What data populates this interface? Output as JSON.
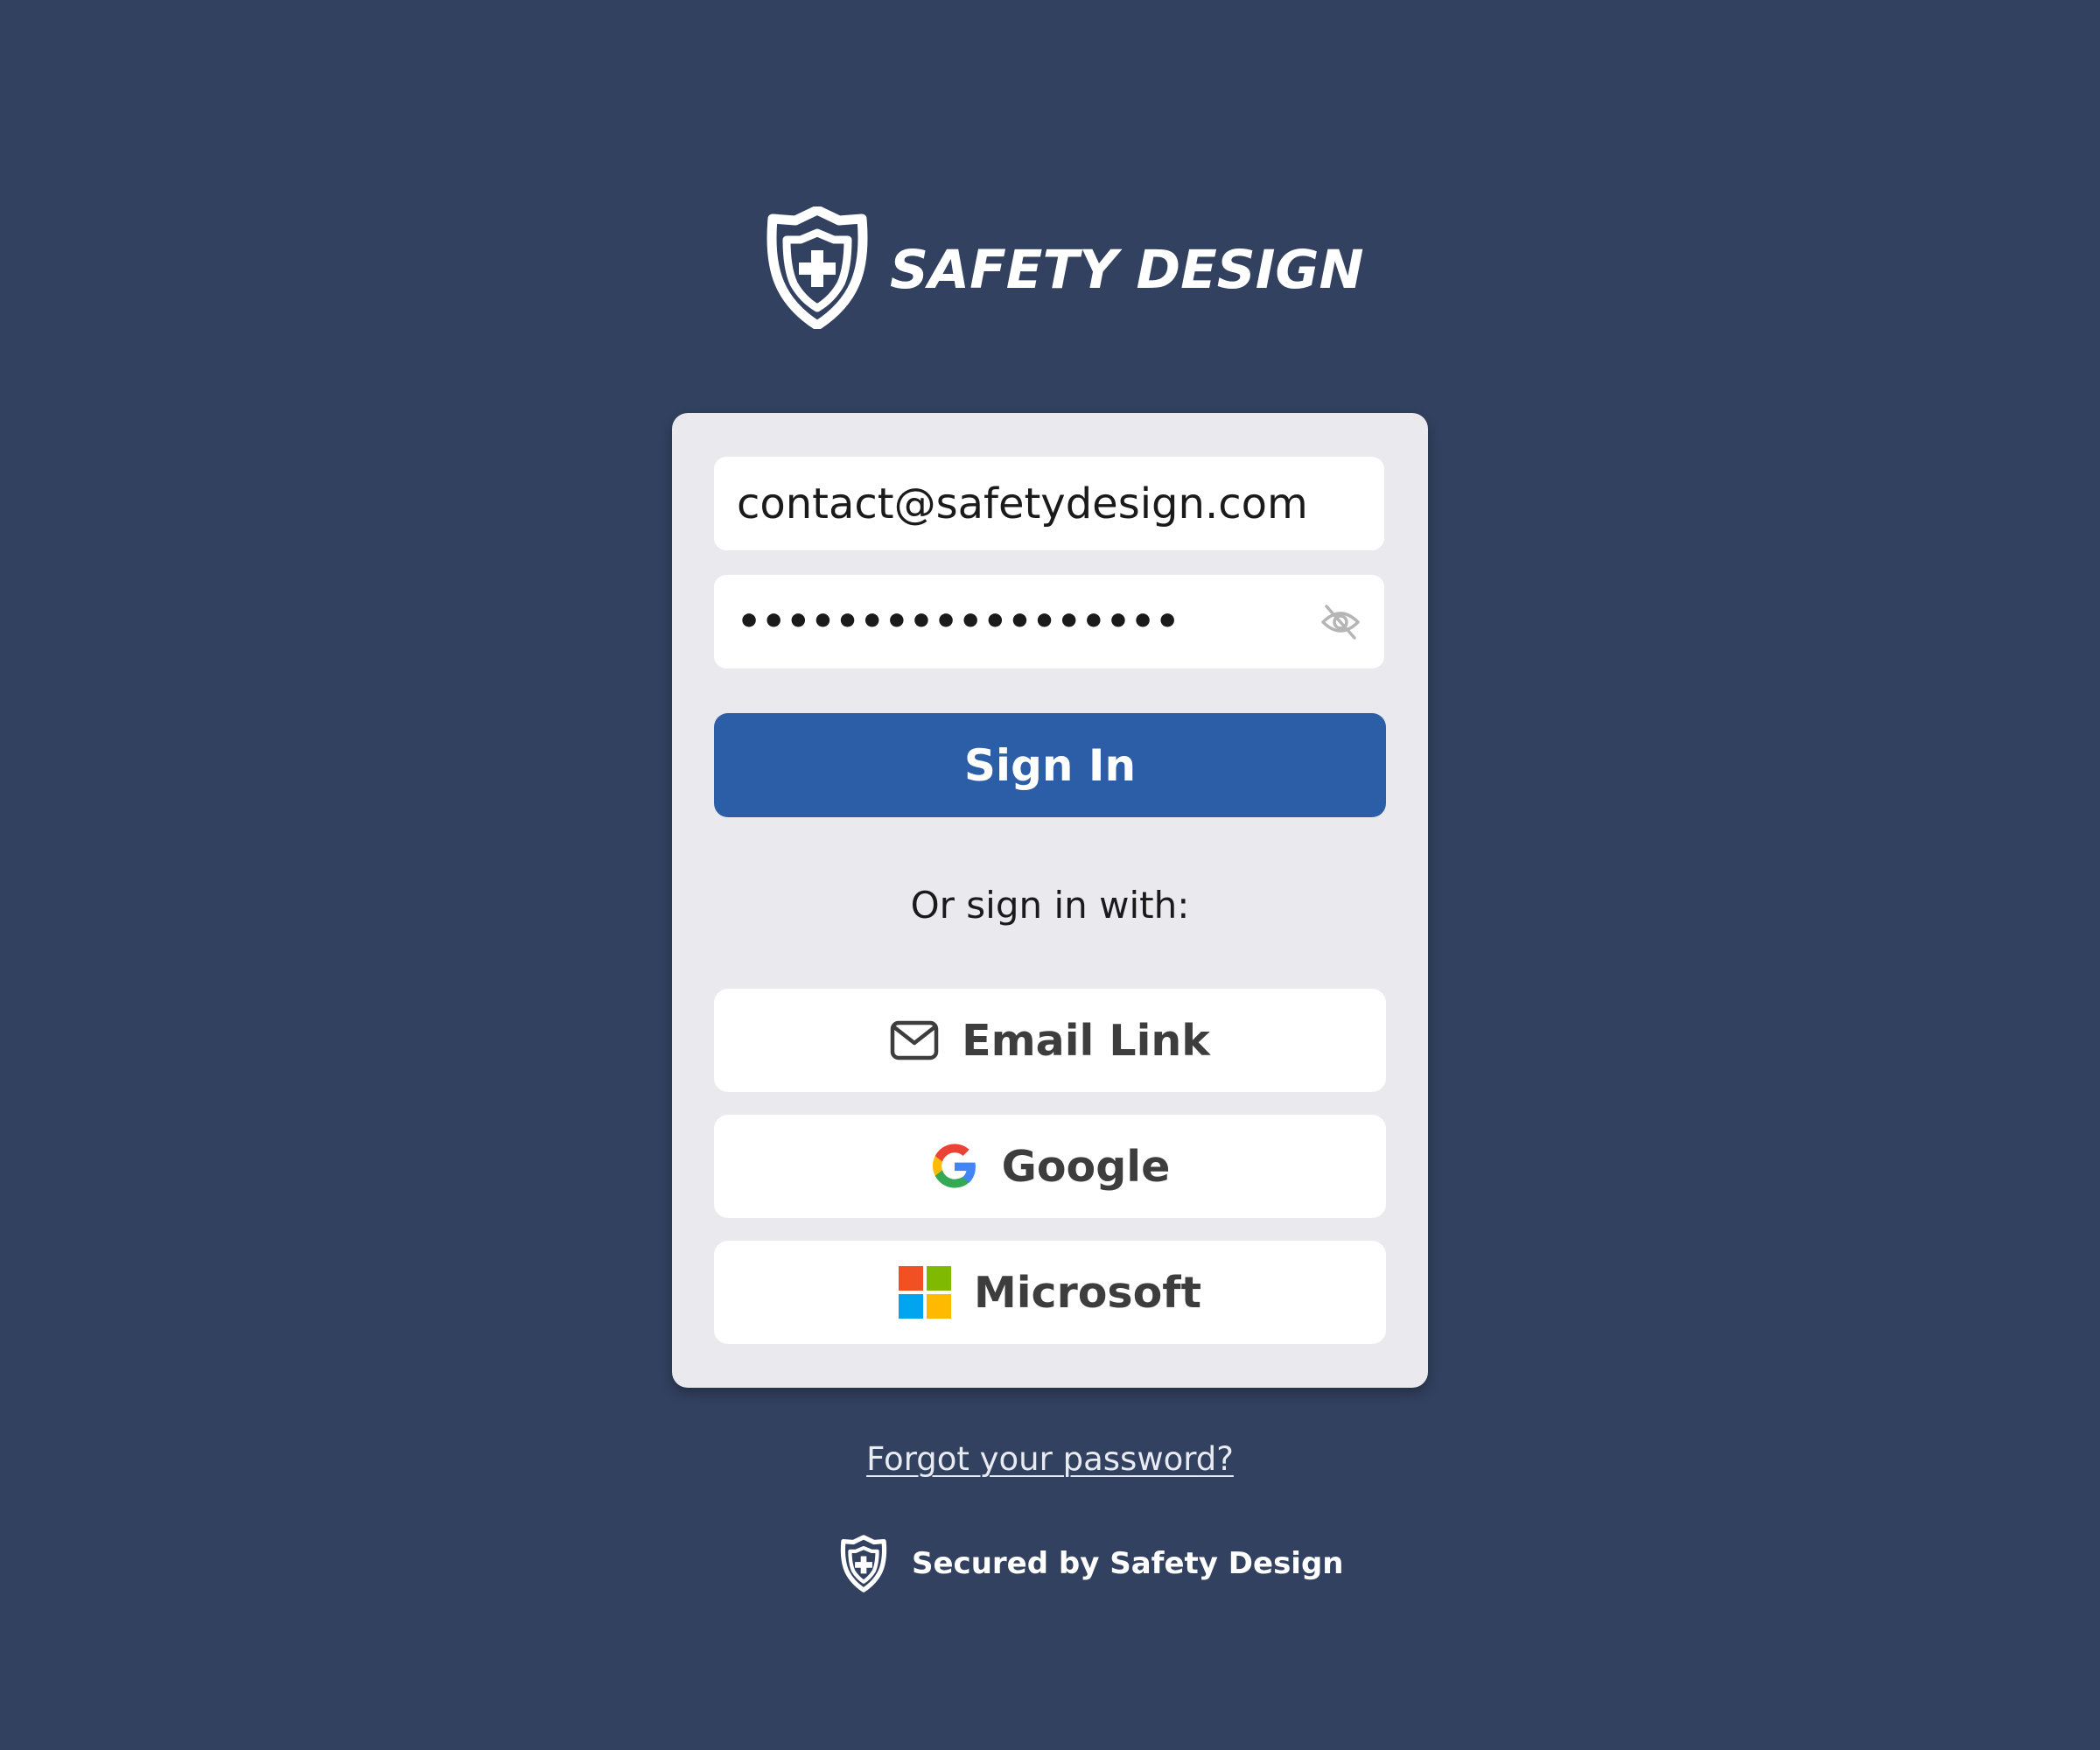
{
  "brand": {
    "name": "SAFETY DESIGN",
    "logo_icon": "shield-plus-icon"
  },
  "login_form": {
    "email_value": "contact@safetydesign.com",
    "password_masked": "••••••••••••••••••",
    "password_toggle_icon": "eye-off-icon",
    "signin_label": "Sign In",
    "alt_signin_text": "Or sign in with:",
    "providers": [
      {
        "label": "Email Link",
        "icon": "envelope-icon"
      },
      {
        "label": "Google",
        "icon": "google-logo-icon"
      },
      {
        "label": "Microsoft",
        "icon": "microsoft-logo-icon"
      }
    ]
  },
  "forgot_password_link": "Forgot your password?",
  "footer": {
    "text": "Secured by Safety Design",
    "icon": "shield-plus-icon"
  },
  "colors": {
    "background": "#324160",
    "card": "#e9e9ee",
    "primary": "#2c5ea8"
  }
}
